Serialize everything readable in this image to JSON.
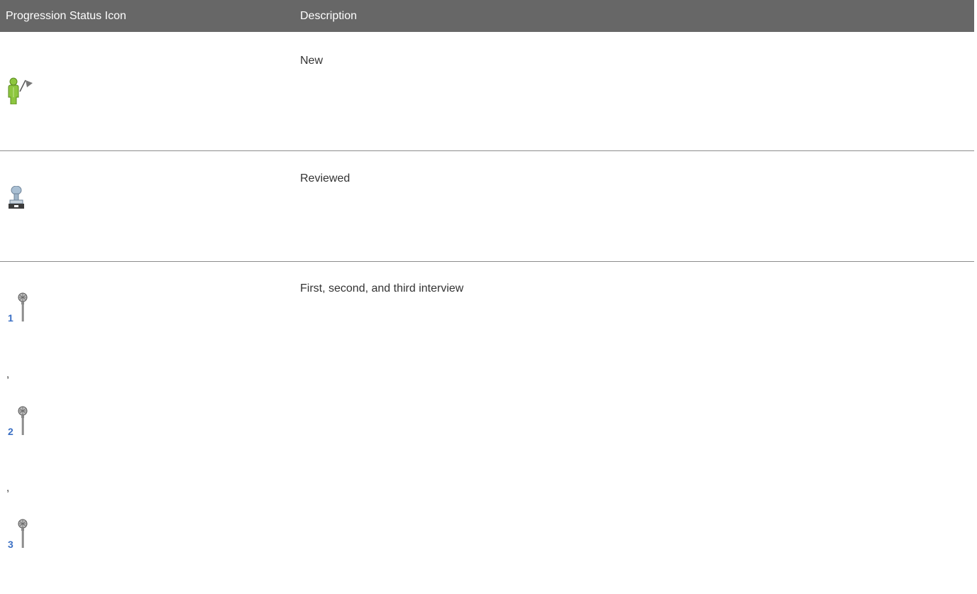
{
  "table": {
    "headers": [
      "Progression Status Icon",
      "Description"
    ],
    "rows": [
      {
        "icons": [
          "person-flag-icon"
        ],
        "description": "New"
      },
      {
        "icons": [
          "stamp-icon"
        ],
        "description": "Reviewed"
      },
      {
        "icons": [
          "interview-1-microphone-icon",
          "interview-2-microphone-icon",
          "interview-3-microphone-icon"
        ],
        "icon_numbers": [
          "1",
          "2",
          "3"
        ],
        "separators": [
          ",",
          ","
        ],
        "description": "First, second, and third interview"
      }
    ]
  },
  "colors": {
    "header_bg": "#676767",
    "header_text": "#ffffff",
    "body_text": "#333333",
    "rule": "#8c8c8c",
    "new_icon_green": "#8dc63f",
    "number_blue": "#3a6fc4"
  }
}
